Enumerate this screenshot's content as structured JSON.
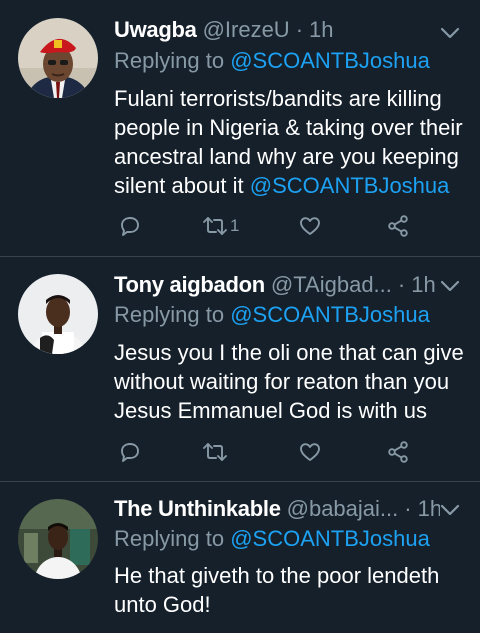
{
  "tweets": [
    {
      "name": "Uwagba",
      "handle": "@IrezeU",
      "dot": "·",
      "time": "1h",
      "reply_prefix": "Replying to",
      "reply_to": "@SCOANTBJoshua",
      "text_lines": [
        "Fulani terrorists/bandits are killing",
        "people in Nigeria & taking over their",
        "ancestral land why are you keeping",
        "silent about it"
      ],
      "text_mention": "@SCOANTBJoshua",
      "retweet_count": "1",
      "avatar_icon": "avatar-red-beret",
      "icons": [
        "reply-icon",
        "retweet-icon",
        "like-icon",
        "share-icon",
        "chevron-down-icon"
      ]
    },
    {
      "name": "Tony aigbadon",
      "handle": "@TAigbad...",
      "dot": "·",
      "time": "1h",
      "reply_prefix": "Replying to",
      "reply_to": "@SCOANTBJoshua",
      "text_lines": [
        "Jesus you I the oli one that can give",
        "without waiting for reaton than you",
        "Jesus Emmanuel God is with us"
      ],
      "retweet_count": "",
      "avatar_icon": "avatar-man-white-shirt"
    },
    {
      "name": "The Unthinkable",
      "handle": "@babajai...",
      "dot": "·",
      "time": "1h",
      "reply_prefix": "Replying to",
      "reply_to": "@SCOANTBJoshua",
      "text_lines": [
        "He that giveth to the poor lendeth",
        "unto God!"
      ],
      "avatar_icon": "avatar-man-indoors"
    }
  ],
  "colors": {
    "background": "#15202b",
    "divider": "#38444d",
    "secondary_text": "#8899a6",
    "link": "#1da1f2",
    "primary_text": "#ffffff"
  }
}
